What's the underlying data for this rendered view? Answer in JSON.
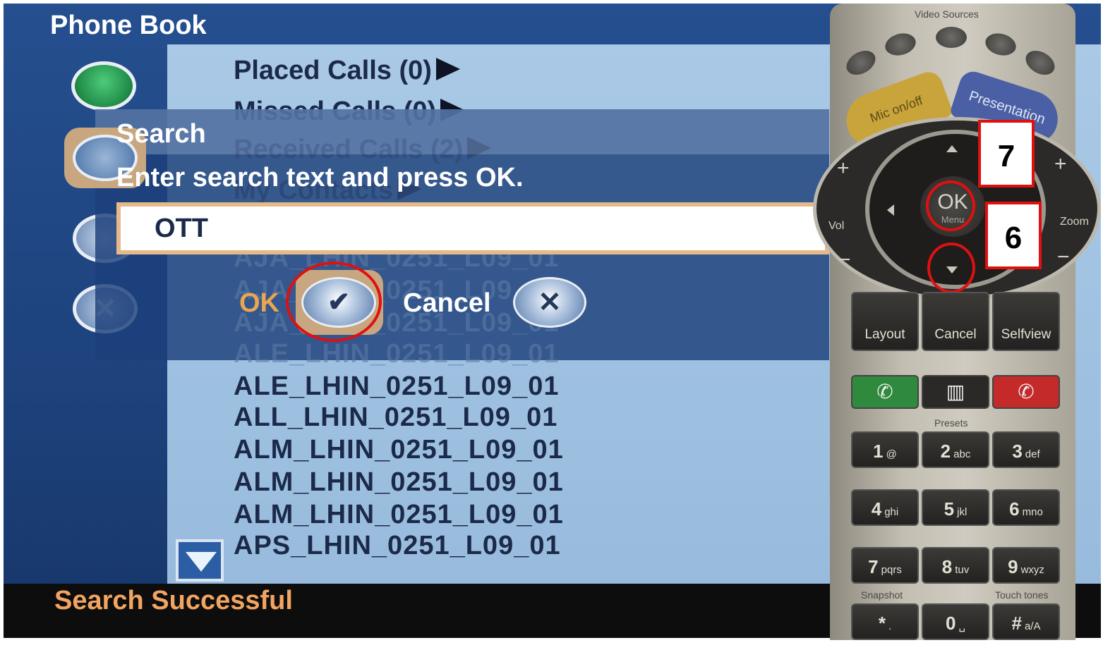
{
  "screen": {
    "title": "Phone Book",
    "menu": [
      {
        "label": "Placed Calls (0)"
      },
      {
        "label": "Missed Calls (0)"
      },
      {
        "label": "Received Calls (2)"
      },
      {
        "label": "My Contacts"
      }
    ],
    "rows": [
      "AJA_LHIN_0251_L09_01",
      "AJA_LHIN_0251_L09_01",
      "AJA_LHIN_0251_L09_01",
      "ALE_LHIN_0251_L09_01",
      "ALE_LHIN_0251_L09_01",
      "ALL_LHIN_0251_L09_01",
      "ALM_LHIN_0251_L09_01",
      "ALM_LHIN_0251_L09_01",
      "ALM_LHIN_0251_L09_01",
      "APS_LHIN_0251_L09_01"
    ],
    "status": "Search Successful"
  },
  "dialog": {
    "title": "Search",
    "prompt": "Enter search text and press OK.",
    "input_value": "OTT",
    "ok_label": "OK",
    "cancel_label": "Cancel"
  },
  "remote": {
    "video_sources_label": "Video Sources",
    "mic_label": "Mic on/off",
    "presentation_label": "Presentation",
    "vol_label": "Vol",
    "zoom_label": "Zoom",
    "ok_label": "OK",
    "menu_label": "Menu",
    "layout_label": "Layout",
    "cancel_label": "Cancel",
    "selfview_label": "Selfview",
    "presets_label": "Presets",
    "snapshot_label": "Snapshot",
    "touchtones_label": "Touch tones",
    "keys": [
      {
        "num": "1",
        "sub": "@"
      },
      {
        "num": "2",
        "sub": "abc"
      },
      {
        "num": "3",
        "sub": "def"
      },
      {
        "num": "4",
        "sub": "ghi"
      },
      {
        "num": "5",
        "sub": "jkl"
      },
      {
        "num": "6",
        "sub": "mno"
      },
      {
        "num": "7",
        "sub": "pqrs"
      },
      {
        "num": "8",
        "sub": "tuv"
      },
      {
        "num": "9",
        "sub": "wxyz"
      },
      {
        "num": "*",
        "sub": "."
      },
      {
        "num": "0",
        "sub": "␣"
      },
      {
        "num": "#",
        "sub": "a/A"
      }
    ]
  },
  "annotations": {
    "step_7": "7",
    "step_6": "6"
  },
  "colors": {
    "ok_accent": "#e9a550",
    "status_text": "#f2a560",
    "highlight_ring": "#e01010"
  }
}
